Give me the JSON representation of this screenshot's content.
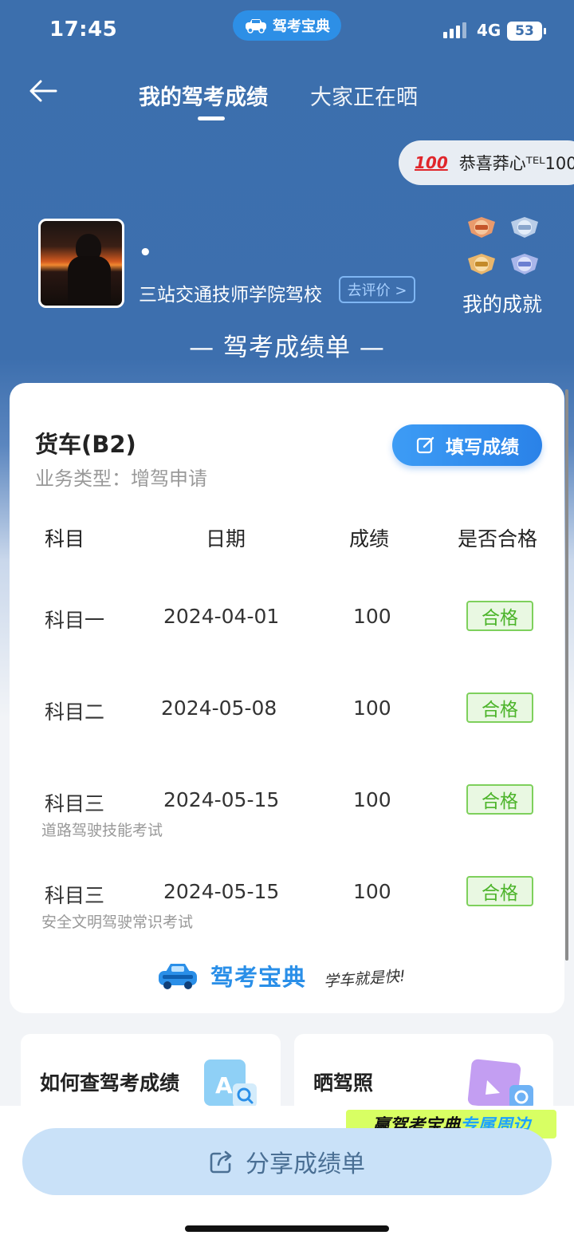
{
  "status_bar": {
    "time": "17:45",
    "app_name": "驾考宝典",
    "network": "4G",
    "battery": "53"
  },
  "nav": {
    "tab_active": "我的驾考成绩",
    "tab_other": "大家正在晒"
  },
  "notice": {
    "emoji": "100",
    "text": "恭喜莽心ᵀᴱᴸ100"
  },
  "profile": {
    "name": "•",
    "school": "三站交通技师学院驾校",
    "review_label": "去评价 >",
    "achievement_label": "我的成就"
  },
  "report_title": "— 驾考成绩单 —",
  "card": {
    "car_type": "货车(B2)",
    "business_type": "业务类型：增驾申请",
    "fill_button": "填写成绩",
    "headers": {
      "subject": "科目",
      "date": "日期",
      "score": "成绩",
      "pass": "是否合格"
    },
    "rows": [
      {
        "subject": "科目一",
        "date": "2024-04-01",
        "score": "100",
        "pass": "合格",
        "note": ""
      },
      {
        "subject": "科目二",
        "date": "2024-05-08",
        "score": "100",
        "pass": "合格",
        "note": ""
      },
      {
        "subject": "科目三",
        "date": "2024-05-15",
        "score": "100",
        "pass": "合格",
        "note": "道路驾驶技能考试"
      },
      {
        "subject": "科目三",
        "date": "2024-05-15",
        "score": "100",
        "pass": "合格",
        "note": "安全文明驾驶常识考试"
      }
    ],
    "brand": "驾考宝典",
    "slogan": "学车就是快!"
  },
  "bottom_cards": {
    "left": "如何查驾考成绩",
    "right": "晒驾照"
  },
  "promo": {
    "part1": "赢驾考宝典",
    "part2": "专属周边"
  },
  "share_button": "分享成绩单",
  "colors": {
    "primary": "#3c6fad",
    "accent": "#2a82e8",
    "pass": "#4cb42a"
  }
}
